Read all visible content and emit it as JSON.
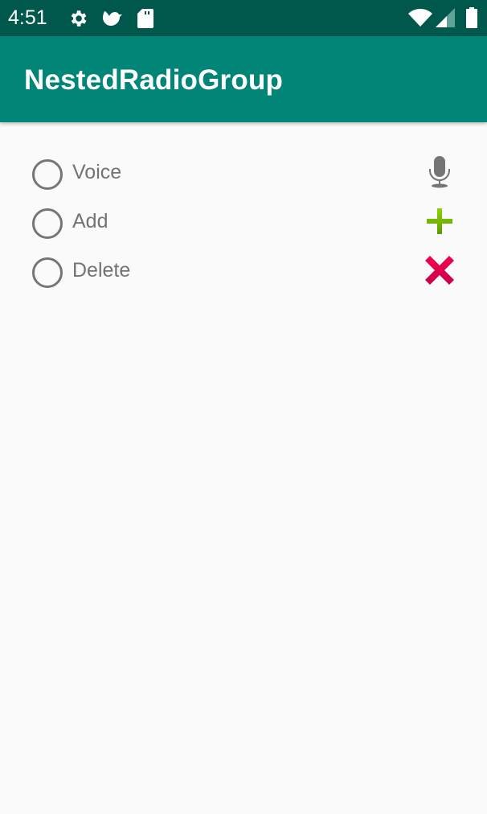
{
  "status_bar": {
    "time": "4:51",
    "icons": [
      "settings-icon",
      "bird-icon",
      "sd-card-icon",
      "wifi-icon",
      "cell-signal-icon",
      "battery-icon"
    ]
  },
  "app_bar": {
    "title": "NestedRadioGroup",
    "color": "#008577"
  },
  "options": [
    {
      "label": "Voice",
      "icon": "microphone-icon",
      "checked": false,
      "icon_color": "#757575"
    },
    {
      "label": "Add",
      "icon": "plus-icon",
      "checked": false,
      "icon_color": "#7cc400"
    },
    {
      "label": "Delete",
      "icon": "delete-x-icon",
      "checked": false,
      "icon_color": "#e8004f"
    }
  ]
}
